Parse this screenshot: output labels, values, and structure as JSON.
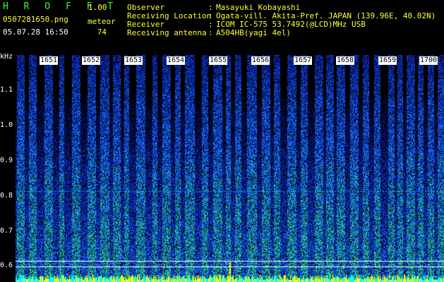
{
  "app": {
    "name": "H R O F F T",
    "version": "1.00"
  },
  "file": {
    "name": "0507281650.png",
    "datetime": "05.07.28 16:50"
  },
  "meteor": {
    "label": "meteor",
    "count": "74"
  },
  "info": [
    {
      "key": "Observer",
      "sep": ":",
      "value": "Masayuki Kobayashi"
    },
    {
      "key": "Receiving Location",
      "sep": ":",
      "value": "Ogata-vill. Akita-Pref. JAPAN (139.96E, 40.02N)"
    },
    {
      "key": "Receiver",
      "sep": ":",
      "value": "ICOM IC-575 53.7492(@LCD)MHz USB"
    },
    {
      "key": "Receiving antenna",
      "sep": ":",
      "value": "A504HB(yagi 4el)"
    }
  ],
  "axis": {
    "unit": "kHz",
    "yticks": [
      "1.1",
      "1.0",
      "0.9",
      "0.8",
      "0.7",
      "0.6"
    ],
    "time_ticks": [
      "1651",
      "1652",
      "1653",
      "1654",
      "1655",
      "1656",
      "1657",
      "1658",
      "1659",
      "1700"
    ]
  },
  "colors": {
    "background": "#000000",
    "label_green": "#32ff32",
    "label_yellow": "#ffff32",
    "spectrum_low": "#0a1a8c",
    "spectrum_mid": "#1e5aff",
    "spectrum_high": "#32ff64",
    "baseline": "#ffff00",
    "marker_line": "#00c8ff"
  }
}
